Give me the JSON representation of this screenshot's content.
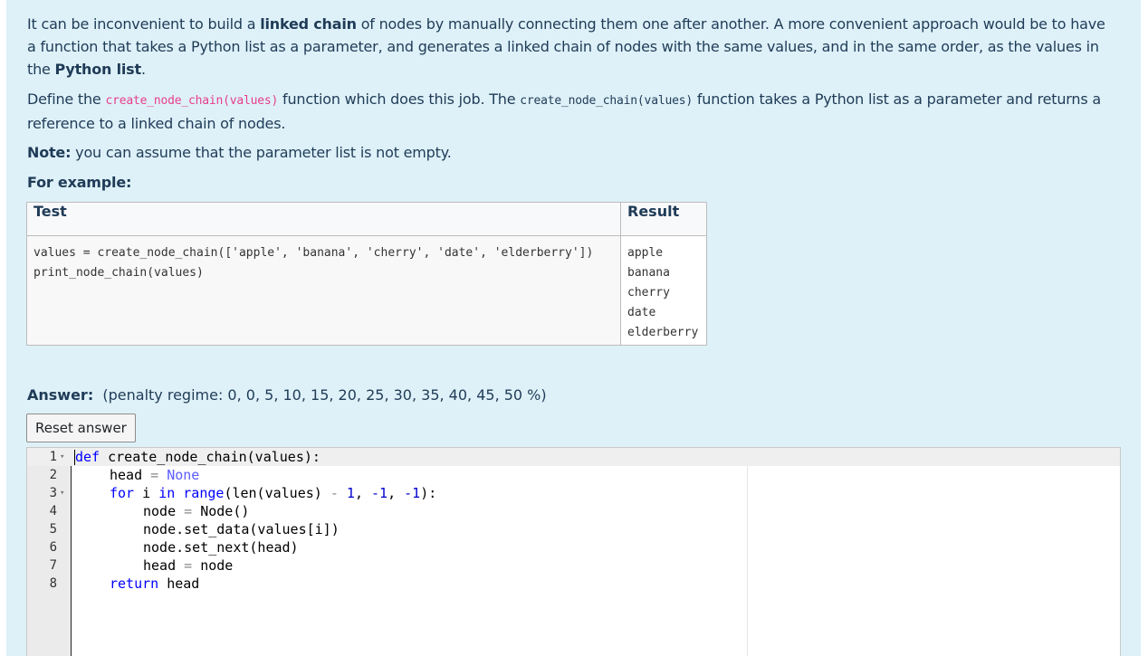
{
  "intro": {
    "t1": "It can be inconvenient to build a ",
    "b1": "linked chain",
    "t2": " of nodes by manually connecting them one after another.  A more convenient approach would be to have a function that takes a Python list as a parameter, and generates a linked chain of nodes with the same values, and in the same order, as the values in the ",
    "b2": "Python list",
    "t3": "."
  },
  "define": {
    "t1": "Define the ",
    "c1": "create_node_chain(values)",
    "t2": " function which does this job. The ",
    "c2": "create_node_chain(values)",
    "t3": " function takes a Python list as a parameter and returns a reference to a linked chain of nodes."
  },
  "note": {
    "label": "Note:",
    "text": " you can assume that the parameter list is not empty."
  },
  "for_example": "For example:",
  "examples_table": {
    "headers": [
      "Test",
      "Result"
    ],
    "test_lines": [
      "values = create_node_chain(['apple', 'banana', 'cherry', 'date', 'elderberry'])",
      "print_node_chain(values)"
    ],
    "result_lines": [
      "apple",
      "banana",
      "cherry",
      "date",
      "elderberry"
    ]
  },
  "answer": {
    "label": "Answer:",
    "penalty": "(penalty regime: 0, 0, 5, 10, 15, 20, 25, 30, 35, 40, 45, 50 %)",
    "reset_label": "Reset answer"
  },
  "editor": {
    "line_numbers": [
      "1",
      "2",
      "3",
      "4",
      "5",
      "6",
      "7",
      "8"
    ],
    "fold_marker": "▾",
    "tokens": {
      "def": "def",
      "fn_sig": " create_node_chain(values):",
      "head_assign": "head ",
      "eq": "=",
      "none": "None",
      "for": "for",
      "i": " i ",
      "in": "in",
      "range_open": "range",
      "range_args": "(len(values) ",
      "minus": "-",
      "one": "1",
      "comma_sp": ", ",
      "neg1": "-1",
      "close": "):",
      "node_assign": "node ",
      "node_ctor": " Node()",
      "set_data": "node.set_data(values[i])",
      "set_next": "node.set_next(head)",
      "head_node": " node",
      "return": "return",
      "ret_head": " head"
    }
  }
}
